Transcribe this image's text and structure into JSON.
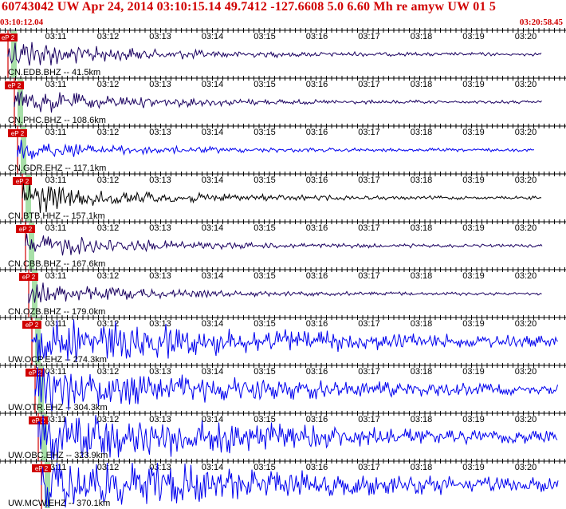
{
  "header": {
    "title": "60743042 UW Apr 24, 2014 03:10:15.14   49.7412 -127.6608  5.0 6.60 Mh re amyw UW 01   5",
    "start_time": "03:10:12.04",
    "end_time": "03:20:58.45"
  },
  "time_ticks": [
    "03:11",
    "03:12",
    "03:13",
    "03:14",
    "03:15",
    "03:16",
    "03:17",
    "03:18",
    "03:19",
    "03:20"
  ],
  "pick_label": "eP 2",
  "colors": {
    "accent": "#d00000",
    "trace_dark": "#1a0060",
    "trace_blue": "#0000ee",
    "pick_band": "#a8e0a8"
  },
  "traces": [
    {
      "label": "CN.EDB.BHZ -- 41.5km",
      "color": "#1a0060",
      "amp": 0.9
    },
    {
      "label": "CN.PHC.BHZ -- 108.6km",
      "color": "#1a0060",
      "amp": 0.7
    },
    {
      "label": "CN.GDR.EHZ -- 117.1km",
      "color": "#0000ee",
      "amp": 0.5
    },
    {
      "label": "CN.BTB.HHZ -- 157.1km",
      "color": "#000000",
      "amp": 0.9
    },
    {
      "label": "CN.CBB.BHZ -- 167.6km",
      "color": "#1a0060",
      "amp": 0.7
    },
    {
      "label": "CN.OZB.BHZ -- 179.0km",
      "color": "#1a0060",
      "amp": 0.6
    },
    {
      "label": "UW.OCP.EHZ -- 274.3km",
      "color": "#0000ee",
      "amp": 1.4
    },
    {
      "label": "UW.OTR.EHZ -- 304.3km",
      "color": "#0000ee",
      "amp": 1.3
    },
    {
      "label": "UW.OBC.EHZ -- 323.9km",
      "color": "#0000ee",
      "amp": 1.6
    },
    {
      "label": "UW.MCW.EHZ -- 370.1km",
      "color": "#0000ee",
      "amp": 1.8
    }
  ]
}
